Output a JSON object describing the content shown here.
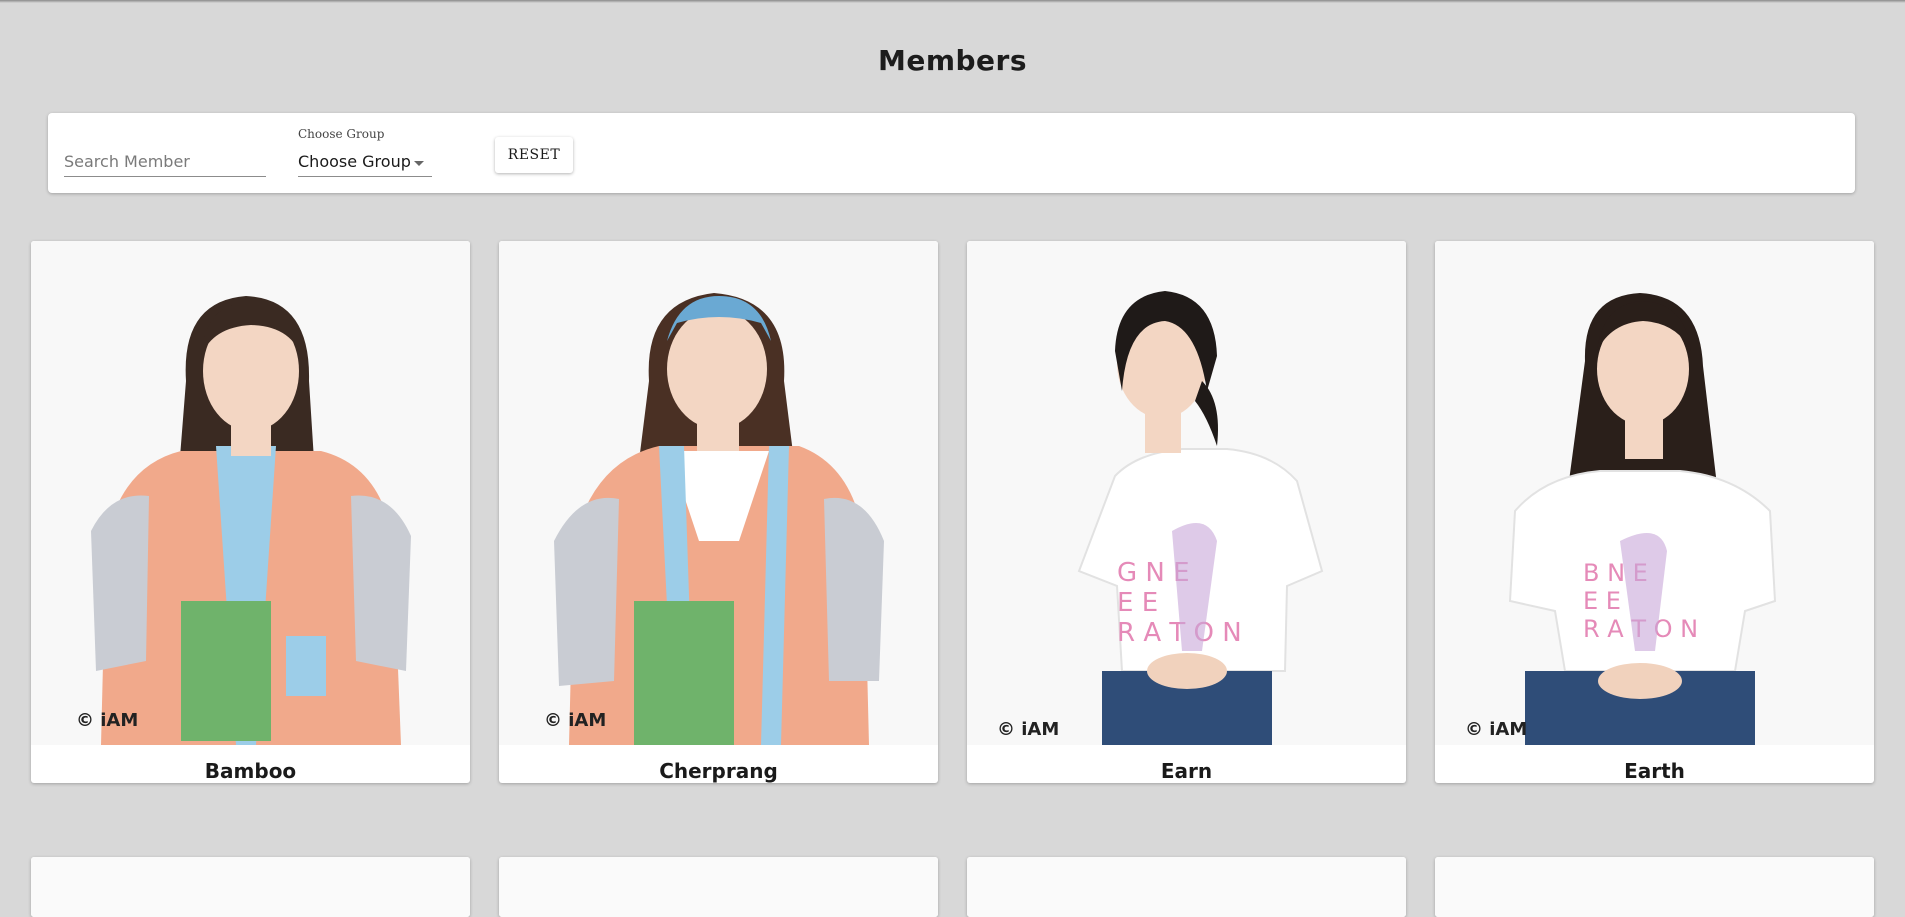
{
  "page": {
    "title": "Members"
  },
  "filters": {
    "search_placeholder": "Search Member",
    "group_label": "Choose Group",
    "group_value": "Choose Group",
    "reset_label": "RESET"
  },
  "members": [
    {
      "name": "Bamboo",
      "watermark": "© iAM",
      "outfit": "jacket",
      "colors": {
        "hair": "#3a2a22",
        "top": "#f1a98b",
        "accent": "#9ccde8",
        "sleeve": "#c9ccd3"
      }
    },
    {
      "name": "Cherprang",
      "watermark": "© iAM",
      "outfit": "jacket",
      "colors": {
        "hair": "#4a3024",
        "top": "#f1a98b",
        "accent": "#9ccde8",
        "sleeve": "#c9ccd3"
      }
    },
    {
      "name": "Earn",
      "watermark": "© iAM",
      "outfit": "tshirt",
      "colors": {
        "hair": "#1f1a18",
        "top": "#ffffff",
        "accent": "#e58ab8",
        "pants": "#2f4d78"
      }
    },
    {
      "name": "Earth",
      "watermark": "© iAM",
      "outfit": "tshirt",
      "colors": {
        "hair": "#2a1f1a",
        "top": "#ffffff",
        "accent": "#e58ab8",
        "pants": "#2f4d78"
      }
    }
  ]
}
